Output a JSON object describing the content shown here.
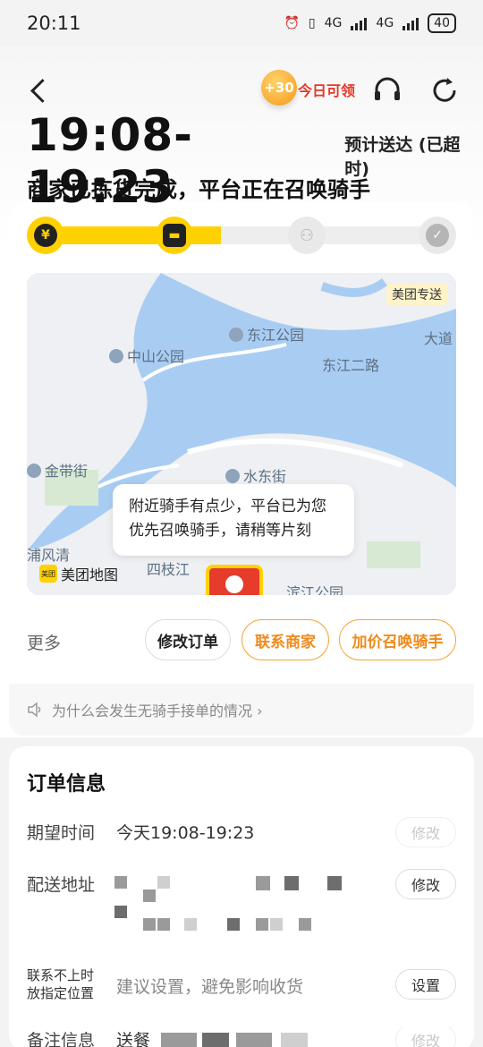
{
  "status_bar": {
    "time": "20:11",
    "network_1": "4G",
    "network_2": "4G",
    "battery": "40"
  },
  "header": {
    "coin_badge": "+30",
    "today_claim": "今日可领"
  },
  "eta": {
    "time_range": "19:08-19:23",
    "note": "预计送达 (已超时)"
  },
  "status_title": "商家已拣货完成，平台正在召唤骑手",
  "progress": {
    "percent_complete": 45,
    "steps": [
      {
        "icon": "yen-icon",
        "state": "done",
        "glyph": "¥"
      },
      {
        "icon": "shop-bag-icon",
        "state": "done",
        "glyph": "▬"
      },
      {
        "icon": "scooter-icon",
        "state": "pending",
        "glyph": "⚇"
      },
      {
        "icon": "check-shield-icon",
        "state": "pending",
        "glyph": "✓"
      }
    ]
  },
  "map": {
    "brand_tag": "美团专送",
    "labels": {
      "dongjiang_park": "东江公园",
      "zhongshan_park": "中山公园",
      "dongjiang_road2": "东江二路",
      "avenue": "大道",
      "jindai_street": "金带街",
      "shuidong_street": "水东街",
      "pufengqing": "浦风清",
      "sizhi_river": "四枝江",
      "binjiang_park": "滨江公园"
    },
    "tip": "附近骑手有点少，平台已为您优先召唤骑手，请稍等片刻",
    "logo_mark": "美团",
    "logo_text": "美团地图"
  },
  "actions": {
    "more_label": "更多",
    "modify_order": "修改订单",
    "contact_merchant": "联系商家",
    "add_price_summon": "加价召唤骑手"
  },
  "why_link": "为什么会发生无骑手接单的情况 ›",
  "order_info": {
    "title": "订单信息",
    "expected_time_label": "期望时间",
    "expected_time_value": "今天19:08-19:23",
    "expected_time_btn": "修改",
    "address_label": "配送地址",
    "address_btn": "修改",
    "unreachable_label_1": "联系不上时",
    "unreachable_label_2": "放指定位置",
    "unreachable_value": "建议设置，避免影响收货",
    "unreachable_btn": "设置",
    "remark_label": "备注信息",
    "remark_value": "送餐",
    "remark_btn": "修改"
  },
  "colors": {
    "brand_yellow": "#ffd100",
    "accent_orange": "#f08a1c",
    "alert_red": "#e23a2a",
    "map_water": "#a9cdf2",
    "map_land": "#eef0f3"
  }
}
